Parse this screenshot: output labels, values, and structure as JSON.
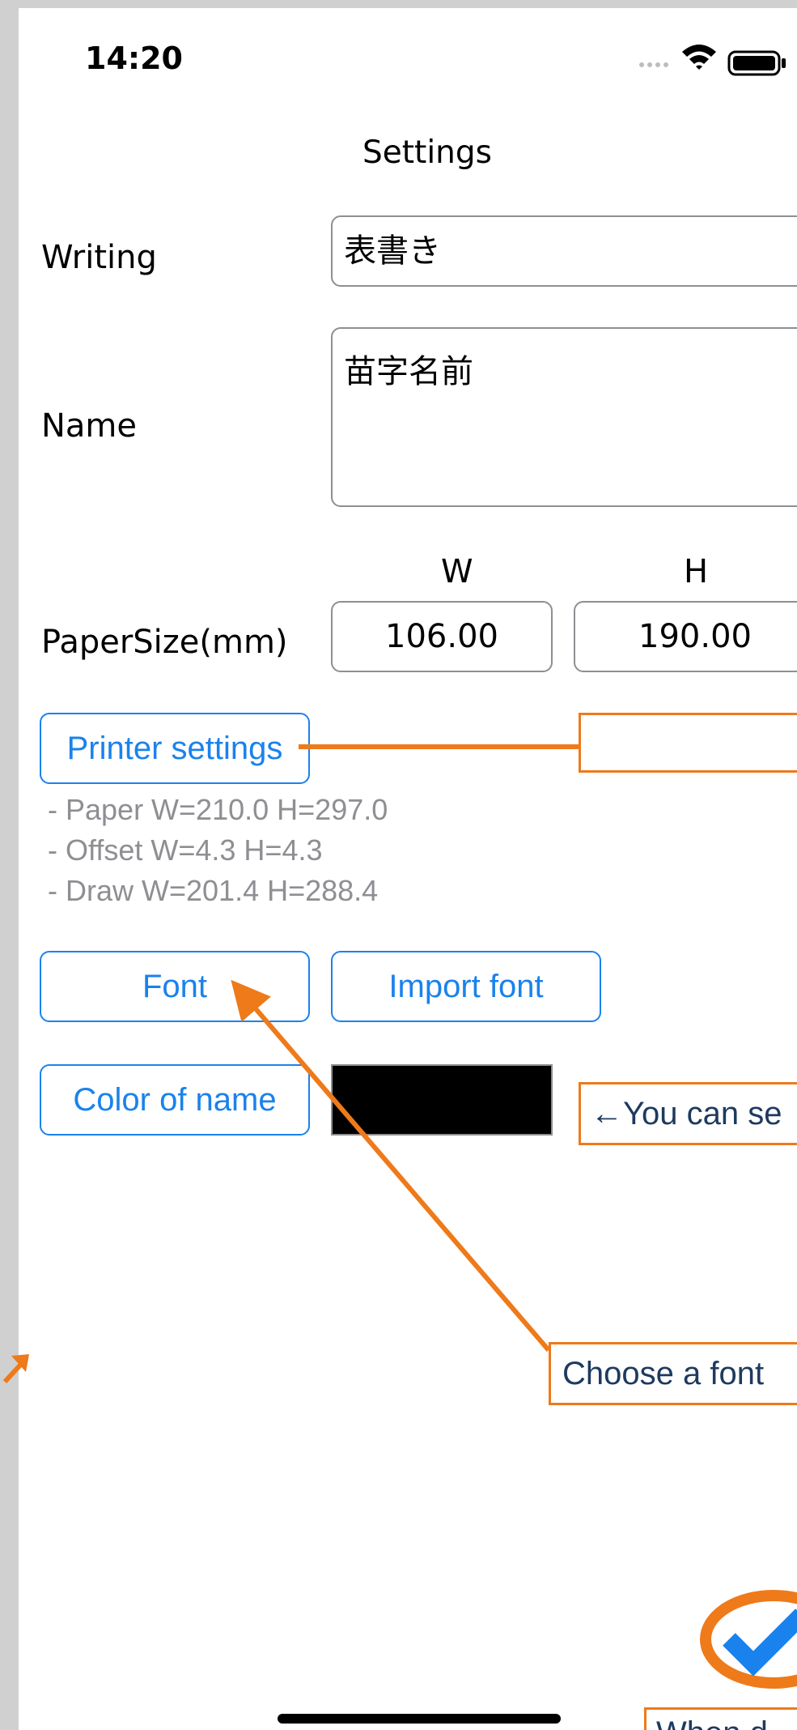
{
  "status_bar": {
    "time": "14:20"
  },
  "header": {
    "title": "Settings"
  },
  "form": {
    "writing_label": "Writing",
    "writing_value": "表書き",
    "name_label": "Name",
    "name_value": "苗字名前",
    "papersize_label": "PaperSize(mm)",
    "width_header": "W",
    "height_header": "H",
    "width_value": "106.00",
    "height_value": "190.00"
  },
  "printer": {
    "button_label": "Printer settings",
    "info_lines": [
      "- Paper W=210.0 H=297.0",
      "- Offset W=4.3 H=4.3",
      "- Draw W=201.4 H=288.4"
    ]
  },
  "font": {
    "font_button": "Font",
    "import_button": "Import font"
  },
  "color": {
    "button_label": "Color of name",
    "swatch_color": "#000000"
  },
  "callouts": {
    "color_tip": "←You can se",
    "font_tip": "Choose a font",
    "bottom_tip": "When d"
  },
  "annotation_color": "#ee7a1a",
  "accent_color": "#1a82ec"
}
